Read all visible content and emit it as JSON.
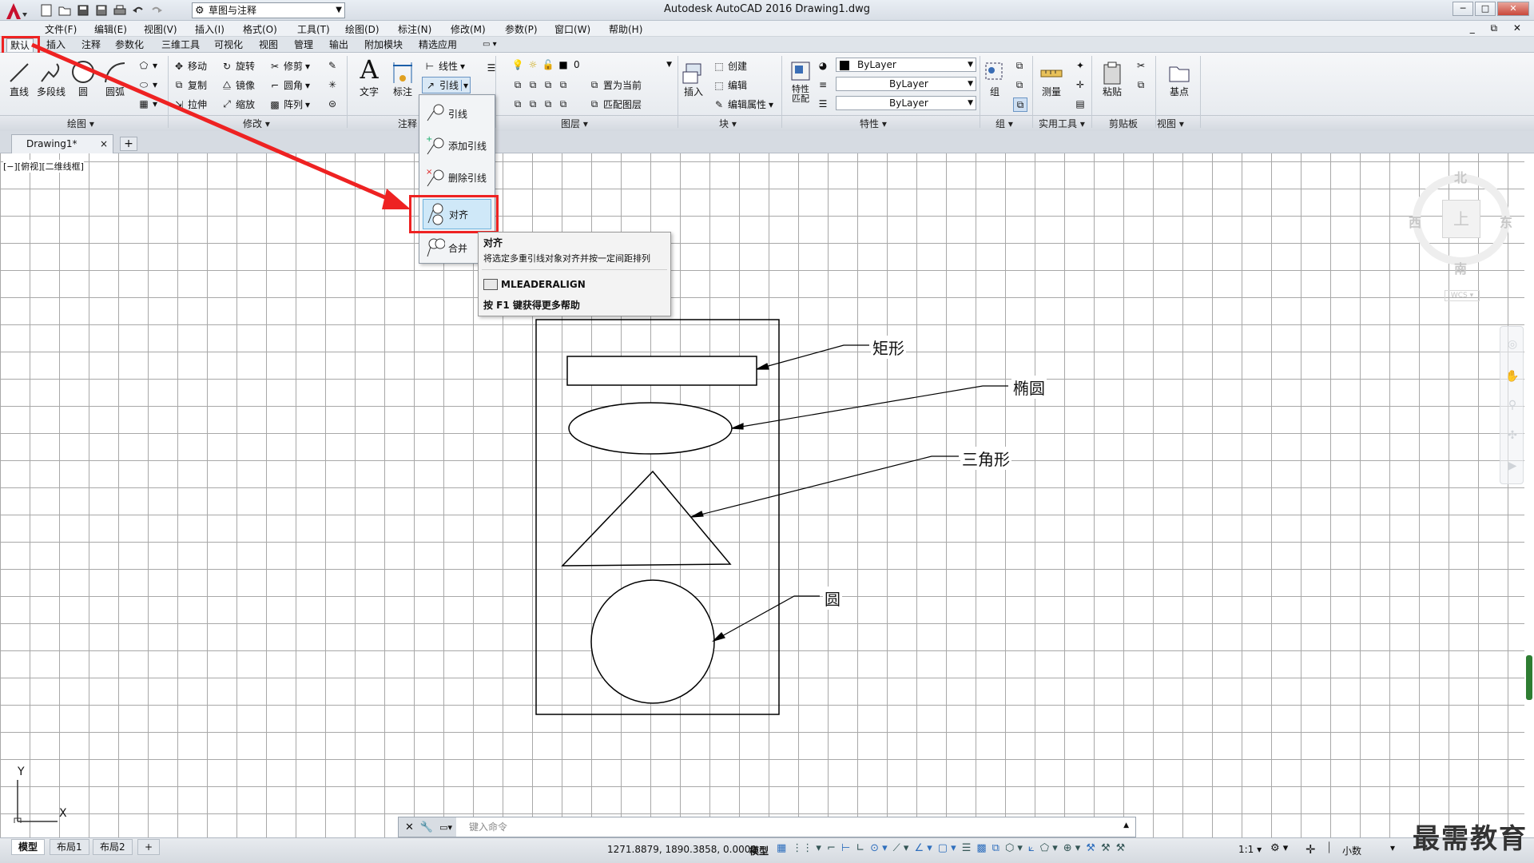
{
  "window": {
    "title": "Autodesk AutoCAD 2016    Drawing1.dwg",
    "workspace": "草图与注释",
    "controls": [
      "─",
      "□",
      "✕"
    ]
  },
  "menubar": {
    "items": [
      "文件(F)",
      "编辑(E)",
      "视图(V)",
      "插入(I)",
      "格式(O)",
      "工具(T)",
      "绘图(D)",
      "标注(N)",
      "修改(M)",
      "参数(P)",
      "窗口(W)",
      "帮助(H)"
    ],
    "mdi_controls": "_ ⧉ ✕"
  },
  "ribbon_tabs": [
    "默认",
    "插入",
    "注释",
    "参数化",
    "三维工具",
    "可视化",
    "视图",
    "管理",
    "输出",
    "附加模块",
    "精选应用"
  ],
  "ribbon": {
    "draw": {
      "title": "绘图 ▾",
      "line": "直线",
      "polyline": "多段线",
      "circle": "圆",
      "arc": "圆弧"
    },
    "modify": {
      "title": "修改 ▾",
      "move": "移动",
      "rotate": "旋转",
      "trim": "修剪",
      "copy": "复制",
      "mirror": "镜像",
      "fillet": "圆角",
      "stretch": "拉伸",
      "scale": "缩放",
      "array": "阵列"
    },
    "annotation": {
      "title": "注释",
      "text": "文字",
      "dimension": "标注",
      "linear": "线性",
      "leader": "引线"
    },
    "layers": {
      "title": "图层 ▾",
      "current_layer": "0",
      "make_current": "置为当前",
      "match_layer": "匹配图层",
      "layer_props": "图层"
    },
    "block": {
      "title": "块 ▾",
      "insert": "插入",
      "create": "创建",
      "edit": "编辑",
      "edit_attr": "编辑属性"
    },
    "properties": {
      "title": "特性 ▾",
      "match": "特性\n匹配",
      "color": "ByLayer",
      "linetype": "ByLayer",
      "lineweight": "ByLayer"
    },
    "groups": {
      "title": "组 ▾",
      "group": "组"
    },
    "utilities": {
      "title": "实用工具 ▾",
      "measure": "测量"
    },
    "clipboard": {
      "title": "剪贴板",
      "paste": "粘贴"
    },
    "view": {
      "title": "视图 ▾",
      "base": "基点"
    }
  },
  "leader_flyout": {
    "items": [
      "引线",
      "添加引线",
      "删除引线",
      "对齐",
      "合并"
    ],
    "highlighted": "对齐"
  },
  "tooltip": {
    "title": "对齐",
    "description": "将选定多重引线对象对齐并按一定间距排列",
    "command": "MLEADERALIGN",
    "help": "按 F1 键获得更多帮助"
  },
  "doc_tabs": {
    "active": "Drawing1*",
    "close": "×",
    "new": "+"
  },
  "viewport_label": "[−][俯视][二维线框]",
  "drawing": {
    "labels": {
      "rectangle": "矩形",
      "ellipse": "椭圆",
      "triangle": "三角形",
      "circle": "圆"
    }
  },
  "viewcube": {
    "north": "北",
    "south": "南",
    "east": "东",
    "west": "西",
    "face": "上",
    "wcs": "WCS ▾"
  },
  "ucs": {
    "x": "X",
    "y": "Y"
  },
  "command_line": {
    "placeholder": "键入命令"
  },
  "statusbar": {
    "layout_tabs": [
      "模型",
      "布局1",
      "布局2"
    ],
    "coords": "1271.8879, 1890.3858, 0.0000",
    "model": "模型",
    "scale": "1:1 ▾",
    "units": "小数"
  },
  "watermark": "最需教育",
  "colors": {
    "accent_red": "#e22222",
    "highlight": "#cfe8f8"
  }
}
